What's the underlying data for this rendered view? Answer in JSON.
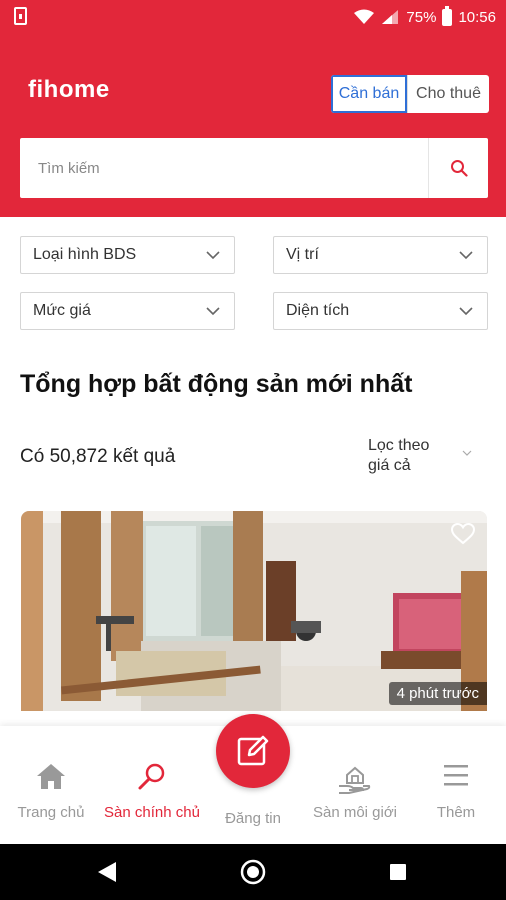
{
  "status_bar": {
    "battery": "75%",
    "time": "10:56"
  },
  "header": {
    "logo": "fihome",
    "toggle": {
      "sell": "Cần bán",
      "rent": "Cho thuê"
    },
    "search_placeholder": "Tìm kiếm"
  },
  "filters": {
    "property_type": "Loại hình BDS",
    "location": "Vị trí",
    "price": "Mức giá",
    "area": "Diện tích"
  },
  "section": {
    "title": "Tổng hợp bất động sản mới nhất",
    "result_count": "Có 50,872 kết quả",
    "sort_line1": "Lọc theo",
    "sort_line2": "giá cả"
  },
  "listing": {
    "time_ago": "4 phút trước"
  },
  "bottom_nav": {
    "home": "Trang chủ",
    "owner_market": "Sàn chính chủ",
    "post": "Đăng tin",
    "broker_market": "Sàn môi giới",
    "more": "Thêm"
  },
  "colors": {
    "brand": "#e2273a",
    "toggle_active": "#2f6fd6"
  },
  "icons": [
    "sim-icon",
    "wifi-icon",
    "signal-icon",
    "battery-icon",
    "search-icon",
    "chevron-down-icon",
    "heart-icon",
    "home-icon",
    "magnifier-icon",
    "edit-icon",
    "hand-house-icon",
    "menu-icon",
    "back-icon",
    "home-circle-icon",
    "recents-icon"
  ]
}
